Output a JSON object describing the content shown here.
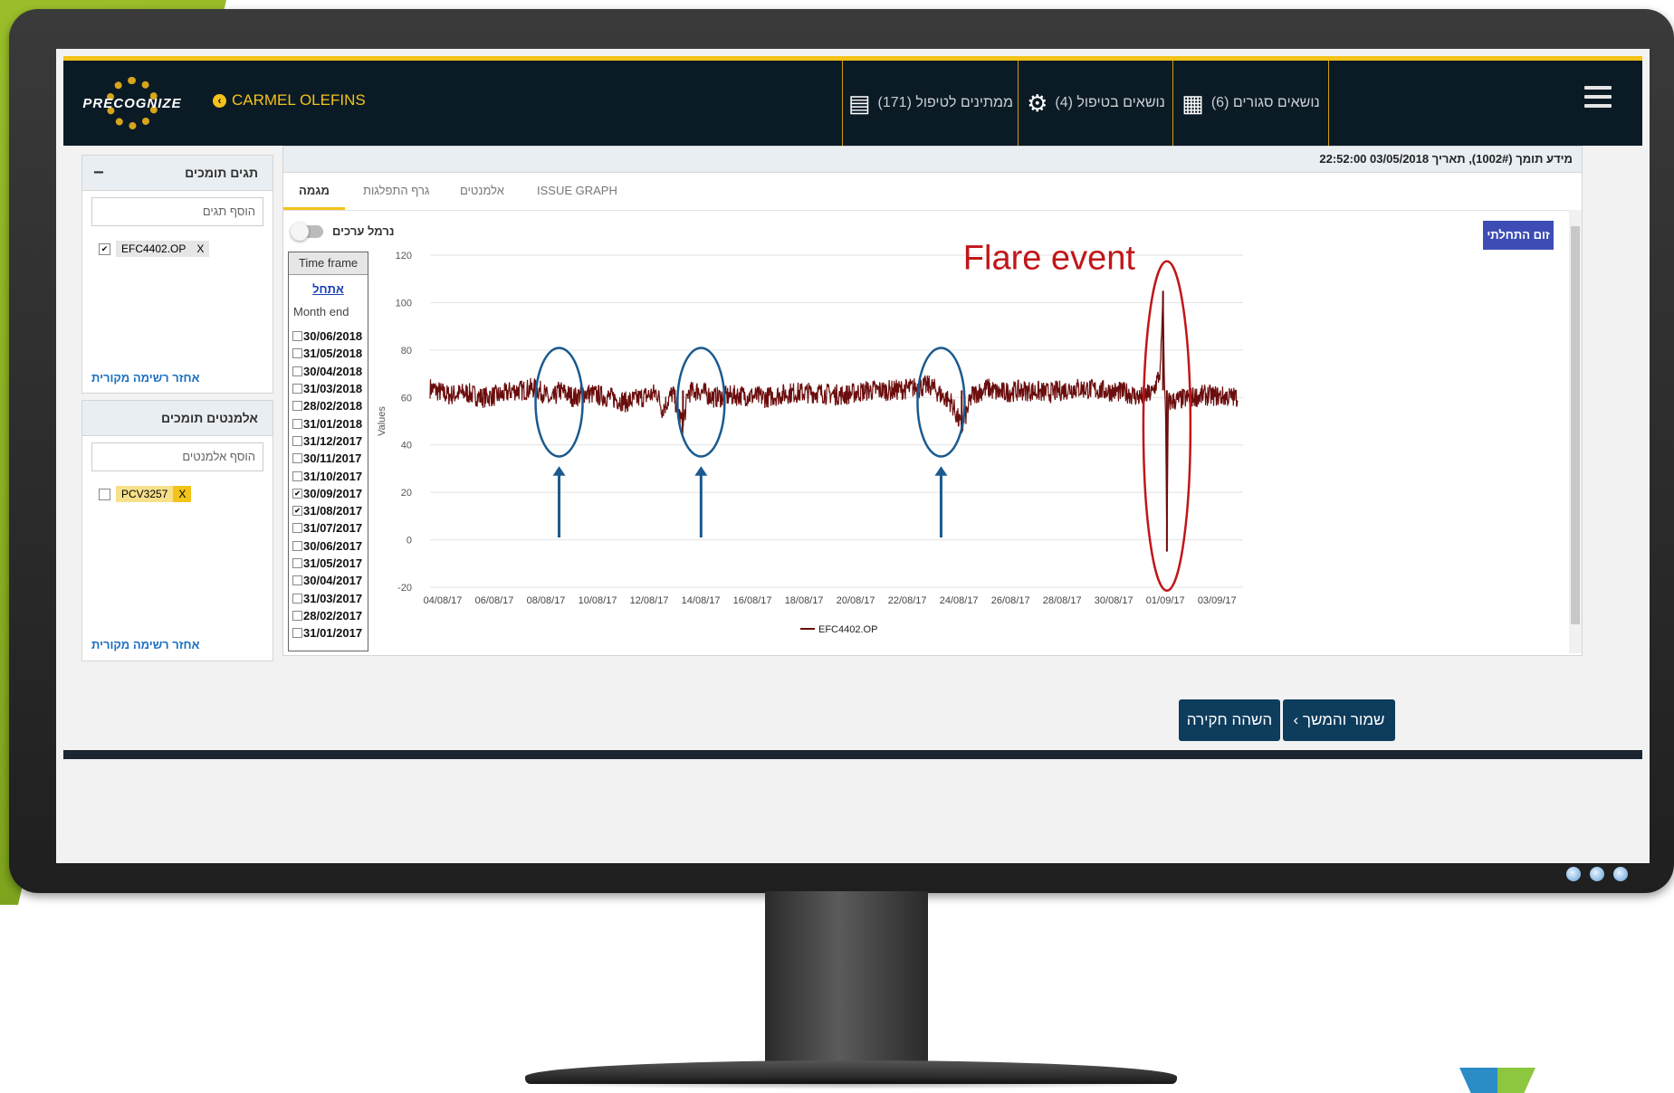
{
  "app": {
    "logo_text": "PRECOGNIZE",
    "plant": "CARMEL OLEFINS",
    "nav": [
      {
        "label": "ממתינים לטיפול (171)",
        "icon": "list-icon"
      },
      {
        "label": "נושאים בטיפול (4)",
        "icon": "gear-icon"
      },
      {
        "label": "נושאים סגורים (6)",
        "icon": "archive-icon"
      }
    ],
    "menu_icon": "hamburger-icon"
  },
  "sidebar": {
    "tags": {
      "title": "תגים תומכים",
      "collapse": "−",
      "placeholder": "הוסף תגים",
      "items": [
        {
          "label": "EFC4402.OP",
          "remove": "X",
          "checked": "✔"
        }
      ],
      "restore": "אחזר רשימה מקורית"
    },
    "elements": {
      "title": "אלמנטים תומכים",
      "placeholder": "הוסף אלמנטים",
      "items": [
        {
          "label": "PCV3257",
          "remove": "X",
          "checked": ""
        }
      ],
      "restore": "אחזר רשימה מקורית"
    }
  },
  "main": {
    "header": "מידע תומך (1002#), תאריך 03/05/2018 22:52:00",
    "tabs": [
      "מגמה",
      "גרף התפלגות",
      "אלמנטים",
      "ISSUE GRAPH"
    ],
    "zoom_button": "זום התחלתי",
    "normalize_label": "נרמל ערכים",
    "timeframe": {
      "title": "Time frame",
      "start": "אתחל",
      "month_end": "Month end",
      "dates": [
        {
          "d": "30/06/2018",
          "c": ""
        },
        {
          "d": "31/05/2018",
          "c": ""
        },
        {
          "d": "30/04/2018",
          "c": ""
        },
        {
          "d": "31/03/2018",
          "c": ""
        },
        {
          "d": "28/02/2018",
          "c": ""
        },
        {
          "d": "31/01/2018",
          "c": ""
        },
        {
          "d": "31/12/2017",
          "c": ""
        },
        {
          "d": "30/11/2017",
          "c": ""
        },
        {
          "d": "31/10/2017",
          "c": ""
        },
        {
          "d": "30/09/2017",
          "c": "✔"
        },
        {
          "d": "31/08/2017",
          "c": "✔"
        },
        {
          "d": "31/07/2017",
          "c": ""
        },
        {
          "d": "30/06/2017",
          "c": ""
        },
        {
          "d": "31/05/2017",
          "c": ""
        },
        {
          "d": "30/04/2017",
          "c": ""
        },
        {
          "d": "31/03/2017",
          "c": ""
        },
        {
          "d": "28/02/2017",
          "c": ""
        },
        {
          "d": "31/01/2017",
          "c": ""
        }
      ]
    },
    "buttons": {
      "save_continue": "שמור והמשך ›",
      "pause": "השהה חקירה"
    }
  },
  "chart_data": {
    "type": "line",
    "ylabel": "Values",
    "ylim": [
      -20,
      120
    ],
    "yticks": [
      120,
      100,
      80,
      60,
      40,
      20,
      0,
      -20
    ],
    "x_labels": [
      "04/08/17",
      "06/08/17",
      "08/08/17",
      "10/08/17",
      "12/08/17",
      "14/08/17",
      "16/08/17",
      "18/08/17",
      "20/08/17",
      "22/08/17",
      "24/08/17",
      "26/08/17",
      "28/08/17",
      "30/08/17",
      "01/09/17",
      "03/09/17"
    ],
    "x_range_days": [
      0,
      31.5
    ],
    "series": [
      {
        "name": "EFC4402.OP",
        "color": "#6b0d0d",
        "baseline": 63,
        "points_day_value": [
          [
            0,
            64
          ],
          [
            0.7,
            61
          ],
          [
            1.4,
            62
          ],
          [
            2,
            60
          ],
          [
            2.8,
            61
          ],
          [
            3.2,
            63
          ],
          [
            3.6,
            63
          ],
          [
            4,
            64
          ],
          [
            4.4,
            62
          ],
          [
            4.7,
            58
          ],
          [
            5,
            63
          ],
          [
            5.6,
            60
          ],
          [
            6,
            62
          ],
          [
            7,
            60
          ],
          [
            7.6,
            58
          ],
          [
            8.2,
            60
          ],
          [
            8.8,
            62
          ],
          [
            9,
            55
          ],
          [
            9.4,
            62
          ],
          [
            9.8,
            48
          ],
          [
            10,
            62
          ],
          [
            10.4,
            63
          ],
          [
            11,
            60
          ],
          [
            12,
            61
          ],
          [
            13,
            60
          ],
          [
            14,
            62
          ],
          [
            15,
            62
          ],
          [
            16,
            61
          ],
          [
            17,
            63
          ],
          [
            18,
            63
          ],
          [
            19.4,
            65
          ],
          [
            19.8,
            61
          ],
          [
            20.2,
            58
          ],
          [
            20.6,
            47
          ],
          [
            21,
            61
          ],
          [
            21.6,
            64
          ],
          [
            22,
            62
          ],
          [
            23,
            63
          ],
          [
            24,
            62
          ],
          [
            25,
            64
          ],
          [
            26,
            63
          ],
          [
            27,
            62
          ],
          [
            27.5,
            60
          ],
          [
            28,
            62
          ],
          [
            28.3,
            71
          ],
          [
            28.4,
            105
          ],
          [
            28.45,
            68
          ],
          [
            28.5,
            52
          ],
          [
            28.55,
            -5
          ],
          [
            28.6,
            58
          ],
          [
            29,
            59
          ],
          [
            30,
            61
          ],
          [
            31.3,
            60
          ]
        ]
      }
    ],
    "annotations": {
      "flare_text": "Flare event",
      "flare_color": "#c0161a",
      "circle_color": "#1a5a8e",
      "circled_days": [
        5,
        10.5,
        19.8
      ],
      "flare_day": 28.55
    }
  }
}
